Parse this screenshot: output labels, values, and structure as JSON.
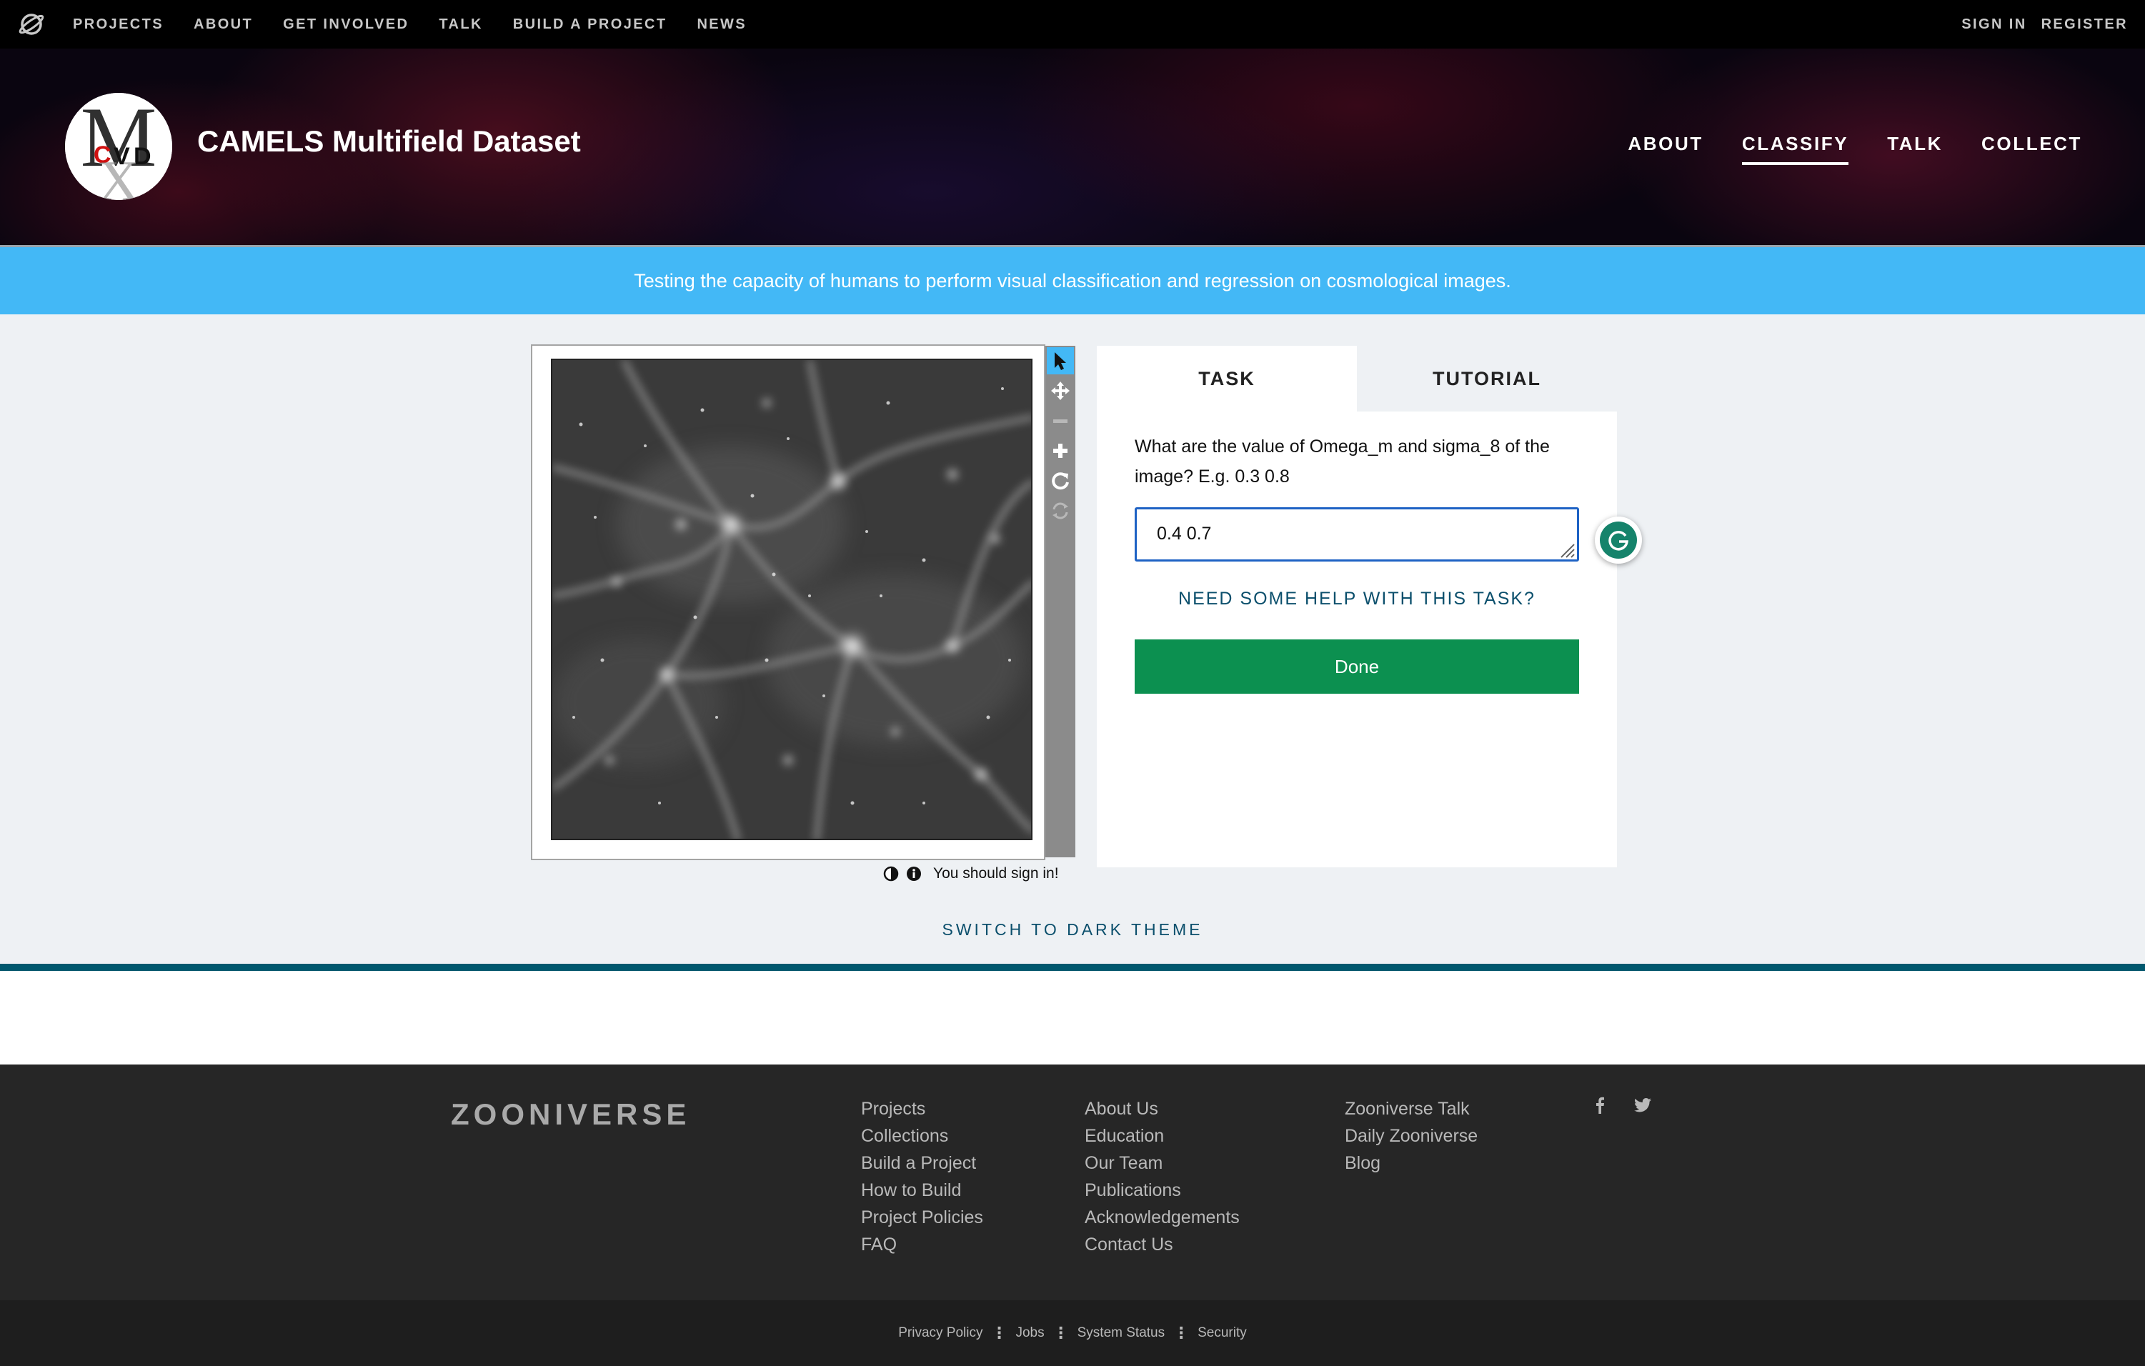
{
  "topnav": {
    "links": [
      "PROJECTS",
      "ABOUT",
      "GET INVOLVED",
      "TALK",
      "BUILD A PROJECT",
      "NEWS"
    ],
    "sign_in": "SIGN IN",
    "register": "REGISTER"
  },
  "project": {
    "title": "CAMELS Multifield Dataset",
    "avatar_letters": "MCVD",
    "nav": [
      "ABOUT",
      "CLASSIFY",
      "TALK",
      "COLLECT"
    ],
    "active_nav": "CLASSIFY"
  },
  "banner": {
    "text": "Testing the capacity of humans to perform visual classification and regression on cosmological images."
  },
  "classifier": {
    "tools": [
      "pointer-icon",
      "move-icon",
      "zoom-out-icon",
      "zoom-in-icon",
      "rotate-icon",
      "reset-icon"
    ],
    "sign_in_note": "You should sign in!",
    "tabs": {
      "task": "TASK",
      "tutorial": "TUTORIAL"
    },
    "question": "What are the value of Omega_m and sigma_8 of the image? E.g. 0.3 0.8",
    "answer_value": "0.4 0.7",
    "help_link": "NEED SOME HELP WITH THIS TASK?",
    "done_label": "Done",
    "dark_theme_label": "SWITCH TO DARK THEME"
  },
  "footer": {
    "brand": "ZOONIVERSE",
    "col1": [
      "Projects",
      "Collections",
      "Build a Project",
      "How to Build",
      "Project Policies",
      "FAQ"
    ],
    "col2": [
      "About Us",
      "Education",
      "Our Team",
      "Publications",
      "Acknowledgements",
      "Contact Us"
    ],
    "col3": [
      "Zooniverse Talk",
      "Daily Zooniverse",
      "Blog"
    ],
    "social": [
      "facebook-icon",
      "twitter-icon"
    ],
    "bottom_links": [
      "Privacy Policy",
      "Jobs",
      "System Status",
      "Security"
    ]
  },
  "colors": {
    "banner": "#43b8f6",
    "done": "#0c9050",
    "teal": "#00586e",
    "input_border": "#1e62c4"
  }
}
